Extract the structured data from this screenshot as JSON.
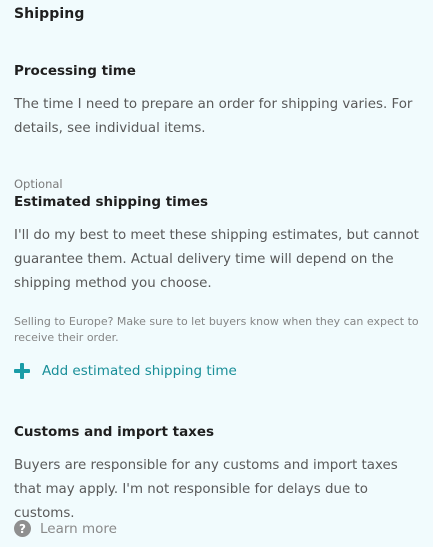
{
  "panel": {
    "title": "Shipping"
  },
  "processing": {
    "heading": "Processing time",
    "description": "The time I need to prepare an order for shipping varies. For details, see individual items."
  },
  "estimates": {
    "optional_label": "Optional",
    "heading": "Estimated shipping times",
    "description": "I'll do my best to meet these shipping estimates, but cannot guarantee them. Actual delivery time will depend on the shipping method you choose.",
    "note": "Selling to Europe? Make sure to let buyers know when they can expect to receive their order.",
    "add_label": "Add estimated shipping time",
    "add_icon": "plus-icon"
  },
  "customs": {
    "heading": "Customs and import taxes",
    "description": "Buyers are responsible for any customs and import taxes that may apply. I'm not responsible for delays due to customs.",
    "learn_more_label": "Learn more",
    "learn_more_icon": "question-circle-icon",
    "learn_more_icon_glyph": "?"
  },
  "colors": {
    "background": "#f1fbfd",
    "accent": "#1a9ca7",
    "muted_text": "#595959"
  }
}
